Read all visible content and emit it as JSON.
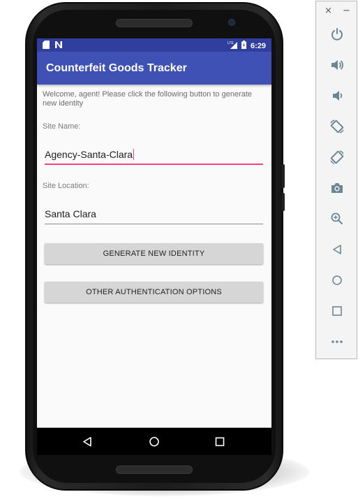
{
  "status_bar": {
    "time": "6:29",
    "network": "LTE"
  },
  "app": {
    "title": "Counterfeit Goods Tracker"
  },
  "content": {
    "welcome_text": "Welcome, agent! Please click the following button to generate new identity",
    "site_name": {
      "label": "Site Name:",
      "value": "Agency-Santa-Clara"
    },
    "site_location": {
      "label": "Site Location:",
      "value": "Santa Clara"
    },
    "buttons": {
      "generate": "GENERATE NEW IDENTITY",
      "other_auth": "OTHER AUTHENTICATION OPTIONS"
    }
  },
  "toolbar": {
    "close": "×",
    "minimize": "−",
    "items": [
      {
        "name": "power-icon"
      },
      {
        "name": "volume-up-icon"
      },
      {
        "name": "volume-down-icon"
      },
      {
        "name": "rotate-left-icon"
      },
      {
        "name": "rotate-right-icon"
      },
      {
        "name": "camera-icon"
      },
      {
        "name": "zoom-icon"
      },
      {
        "name": "back-icon"
      },
      {
        "name": "home-icon"
      },
      {
        "name": "overview-icon"
      },
      {
        "name": "more-icon"
      }
    ]
  },
  "colors": {
    "primary": "#3f51b5",
    "primary_dark": "#303f9f",
    "accent": "#ff4081"
  }
}
